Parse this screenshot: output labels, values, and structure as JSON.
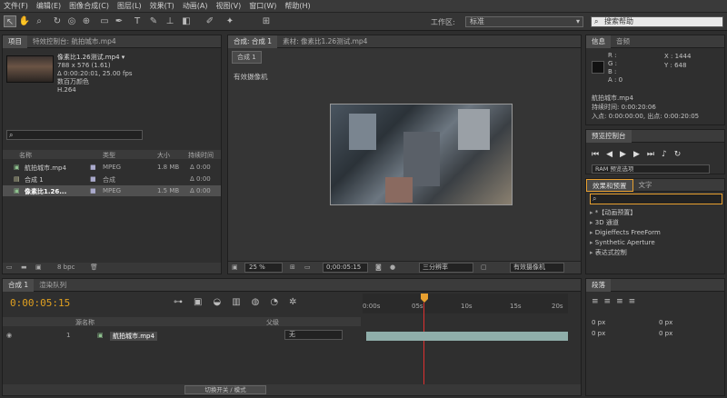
{
  "menu": [
    "文件(F)",
    "编辑(E)",
    "图像合成(C)",
    "图层(L)",
    "效果(T)",
    "动画(A)",
    "视图(V)",
    "窗口(W)",
    "帮助(H)"
  ],
  "toolbar": {
    "workspace_label": "工作区:",
    "workspace_value": "标准",
    "search_help": "搜索帮助"
  },
  "project": {
    "tab1": "项目",
    "tab2": "特效控制台: 航拍城市.mp4",
    "info_name": "像素比1.26测试.mp4 ▾",
    "info_dims": "788 x 576 (1.61)",
    "info_dur": "Δ 0:00:20:01, 25.00 fps",
    "info_color": "数百万颜色",
    "info_codec": "H.264",
    "col_name": "名称",
    "col_type": "类型",
    "col_size": "大小",
    "col_dur": "持续时间",
    "items": [
      {
        "name": "航拍城市.mp4",
        "type": "MPEG",
        "size": "1.8 MB",
        "dur": "Δ 0:00"
      },
      {
        "name": "合成 1",
        "type": "合成",
        "size": "",
        "dur": "Δ 0:00"
      },
      {
        "name": "像素比1.26...",
        "type": "MPEG",
        "size": "1.5 MB",
        "dur": "Δ 0:00"
      }
    ],
    "bpc": "8 bpc"
  },
  "comp": {
    "tab_comp": "合成: 合成 1",
    "tab_footage": "素材: 像素比1.26测试.mp4",
    "crumb": "合成 1",
    "camera": "有效摄像机",
    "zoom": "25 %",
    "time": "0;00:05:15",
    "res": "三分辨率",
    "view": "有效摄像机"
  },
  "info": {
    "tab1": "信息",
    "tab2": "音频",
    "r": "R :",
    "g": "G :",
    "b": "B :",
    "a": "A : 0",
    "x": "X : 1444",
    "y": "Y : 648",
    "file": "航拍城市.mp4",
    "dur": "持续时间: 0:00:20:06",
    "inout": "入点: 0:00:00:00, 出点: 0:00:20:05"
  },
  "preview": {
    "tab": "预览控制台",
    "ram": "RAM 预览选项"
  },
  "effects": {
    "tab1": "效果和预置",
    "tab2": "文字",
    "search": "",
    "list": [
      "*【动画预置】",
      "3D 通道",
      "Digieffects FreeForm",
      "Synthetic Aperture",
      "表达式控制"
    ]
  },
  "timeline": {
    "tab1": "合成 1",
    "tab2": "渲染队列",
    "time": "0:00:05:15",
    "col_source": "源名称",
    "col_parent": "父级",
    "layer_num": "1",
    "layer_name": "航拍城市.mp4",
    "parent_val": "无",
    "ruler": [
      "0:00s",
      "05s",
      "10s",
      "15s",
      "20s"
    ],
    "switch_mode": "切换开关 / 模式"
  },
  "paragraph": {
    "tab": "段落",
    "v1": "0 px",
    "v2": "0 px",
    "v3": "0 px",
    "v4": "0 px",
    "v5": "0 px"
  },
  "colors": {
    "accent": "#e8a030",
    "timecode": "#e0a020"
  }
}
